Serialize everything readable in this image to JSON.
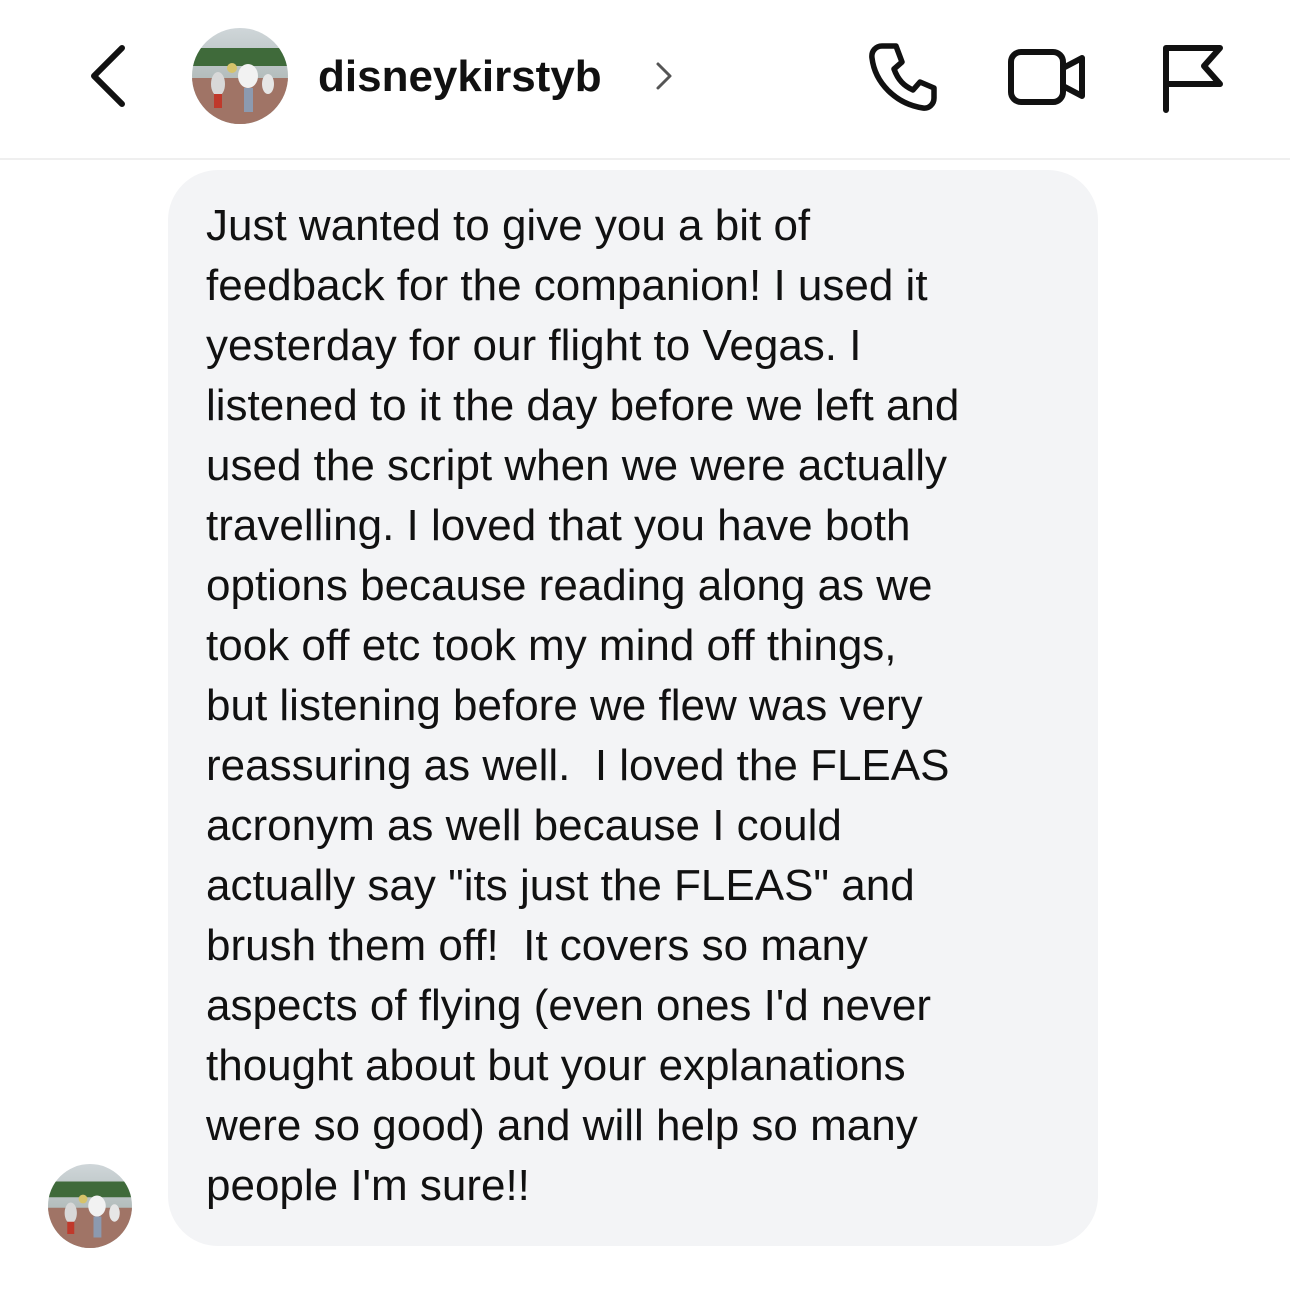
{
  "header": {
    "username": "disneykirstyb",
    "icons": {
      "back": "chevron-left-icon",
      "profile_chevron": "chevron-right-icon",
      "call": "phone-icon",
      "video": "video-camera-icon",
      "report": "flag-icon"
    }
  },
  "message": {
    "lines": [
      "Just wanted to give you a bit of",
      "feedback for the companion! I used it",
      "yesterday for our flight to Vegas. I",
      "listened to it the day before we left and",
      "used the script when we were actually",
      "travelling. I loved that you have both",
      "options because reading along as we",
      "took off etc took my mind off things,",
      "but listening before we flew was very",
      "reassuring as well.  I loved the FLEAS",
      "acronym as well because I could",
      "actually say \"its just the FLEAS\" and",
      "brush them off!  It covers so many",
      "aspects of flying (even ones I'd never",
      "thought about but your explanations",
      "were so good) and will help so many",
      "people I'm sure!!"
    ]
  },
  "colors": {
    "bubble_background": "#f3f4f6",
    "text": "#111111",
    "divider": "#efefef",
    "icon_secondary": "#555555"
  }
}
